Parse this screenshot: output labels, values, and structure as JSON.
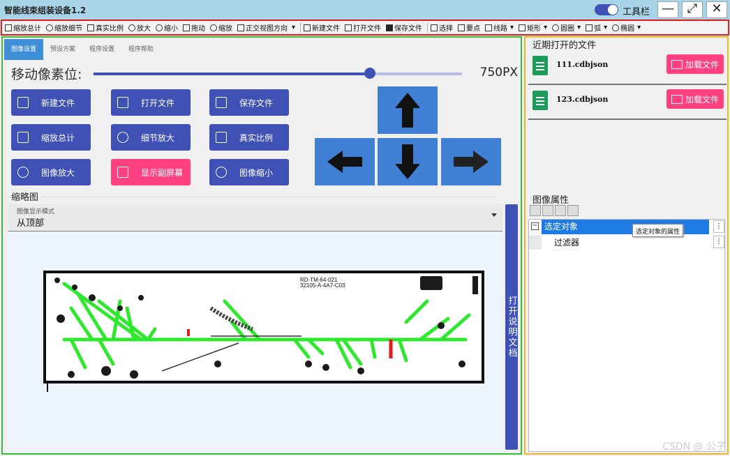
{
  "window": {
    "title": "智能线束组装设备1.2",
    "toggle_label": "工具栏",
    "minimize": "—",
    "maximize": "⤢",
    "close": "✕"
  },
  "toolbar": {
    "items": [
      "缩放总计",
      "缩放细节",
      "真实比例",
      "放大",
      "缩小",
      "拖动",
      "缩放",
      "正交视图方向",
      "新建文件",
      "打开文件",
      "保存文件",
      "选择",
      "要点",
      "线路",
      "矩形",
      "圆圈",
      "弧",
      "椭圆"
    ]
  },
  "tabs": [
    "图像设置",
    "预设方案",
    "程序设置",
    "程序帮助"
  ],
  "move": {
    "label": "移动像素位:",
    "value": "750PX",
    "slider_fraction": 0.75
  },
  "buttons": {
    "new_file": "新建文件",
    "open_file": "打开文件",
    "save_file": "保存文件",
    "zoom_total": "缩放总计",
    "detail_zoom": "细节放大",
    "real_scale": "真实比例",
    "image_zoom_in": "图像放大",
    "show_sub_screen": "显示副屏幕",
    "image_zoom_out": "图像缩小"
  },
  "thumbnail": {
    "title": "缩略图",
    "mode_label": "图像显示模式",
    "mode_value": "从顶部",
    "drawing_text_1": "RD-TM-64-021",
    "drawing_text_2": "32105-A-4A7-C03"
  },
  "help_button": "打开说明文档",
  "recent": {
    "title": "近期打开的文件",
    "files": [
      {
        "name": "111.cdbjson",
        "action": "加载文件"
      },
      {
        "name": "123.cdbjson",
        "action": "加载文件"
      }
    ]
  },
  "properties": {
    "title": "图像属性",
    "rows": [
      {
        "label": "选定对象",
        "tooltip": "选定对象的属性"
      },
      {
        "label": "过滤器"
      }
    ]
  },
  "watermark": "CSDN @ 公子",
  "colors": {
    "primary": "#3f51b5",
    "accent": "#ff4081",
    "arrow_pad": "#3f7fd4",
    "selection": "#1e7be6",
    "toolbar_border": "#e01b1b",
    "left_border": "#3dbb3d",
    "right_border": "#f2b531"
  }
}
